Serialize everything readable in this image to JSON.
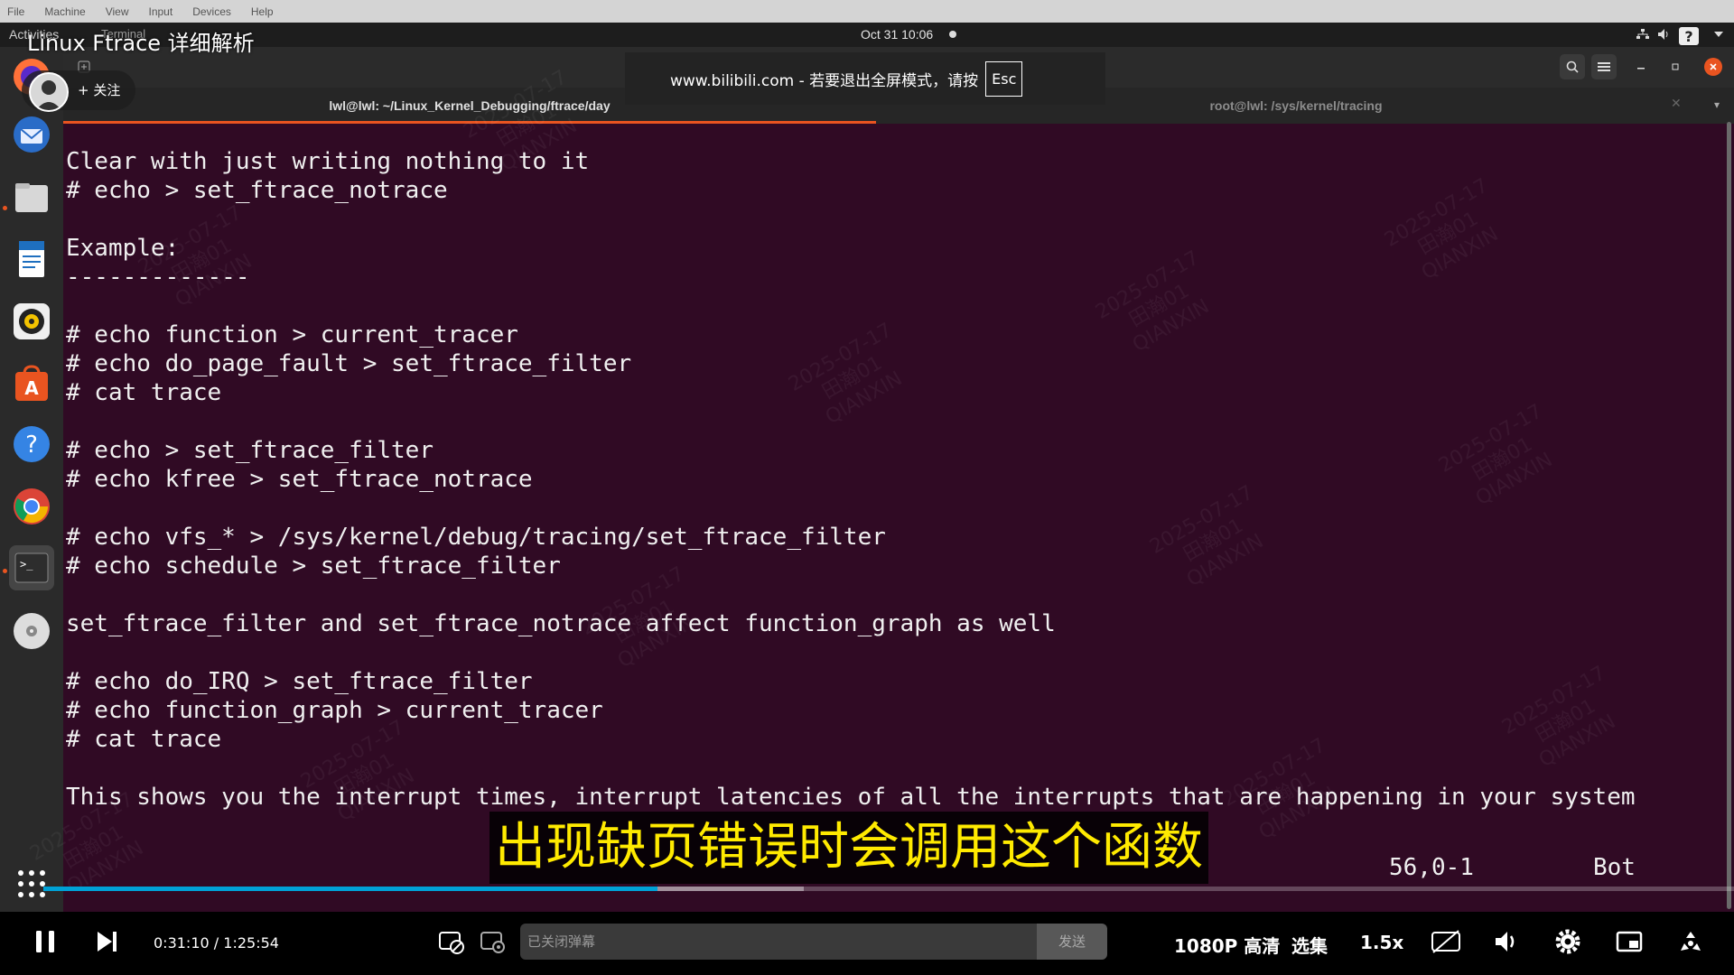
{
  "vm_menu": [
    "File",
    "Machine",
    "View",
    "Input",
    "Devices",
    "Help"
  ],
  "topbar": {
    "activities": "Activities",
    "app_name": "Terminal",
    "clock": "Oct 31  10:06"
  },
  "video": {
    "title": "Linux Ftrace 详细解析",
    "follow_label": "+ 关注"
  },
  "fullscreen_toast": {
    "message": "www.bilibili.com - 若要退出全屏模式，请按",
    "key": "Esc"
  },
  "terminal": {
    "tabs": [
      {
        "label": "lwl@lwl: ~/Linux_Kernel_Debugging/ftrace/day",
        "active": true
      },
      {
        "label": "root@lwl: /sys/kernel/tracing",
        "active": false
      }
    ],
    "lines": [
      "Clear with just writing nothing to it",
      "# echo > set_ftrace_notrace",
      "",
      "Example:",
      "-------------",
      "",
      "# echo function > current_tracer",
      "# echo do_page_fault > set_ftrace_filter",
      "# cat trace",
      "",
      "# echo > set_ftrace_filter",
      "# echo kfree > set_ftrace_notrace",
      "",
      "# echo vfs_* > /sys/kernel/debug/tracing/set_ftrace_filter",
      "# echo schedule > set_ftrace_filter",
      "",
      "set_ftrace_filter and set_ftrace_notrace affect function_graph as well",
      "",
      "# echo do_IRQ > set_ftrace_filter",
      "# echo function_graph > current_tracer",
      "# cat trace",
      "",
      "This shows you the interrupt times, interrupt latencies of all the interrupts that are happening in your system"
    ],
    "status_position": "56,0-1",
    "status_scroll": "Bot"
  },
  "watermark": {
    "date": "2025-07-17",
    "user": "田瀚01",
    "org": "QIANXIN"
  },
  "subtitle": "出现缺页错误时会调用这个函数",
  "player": {
    "current_time": "0:31:10",
    "separator": "/",
    "duration": "1:25:54",
    "progress_fraction": 0.363,
    "buffered_fraction": 0.45,
    "danmaku_placeholder": "已关闭弹幕",
    "send_label": "发送",
    "quality": "1080P 高清",
    "episodes": "选集",
    "speed": "1.5x"
  },
  "colors": {
    "terminal_bg": "#300a24",
    "accent": "#e95420",
    "progress": "#00a1d6",
    "subtitle": "#ffea00"
  }
}
